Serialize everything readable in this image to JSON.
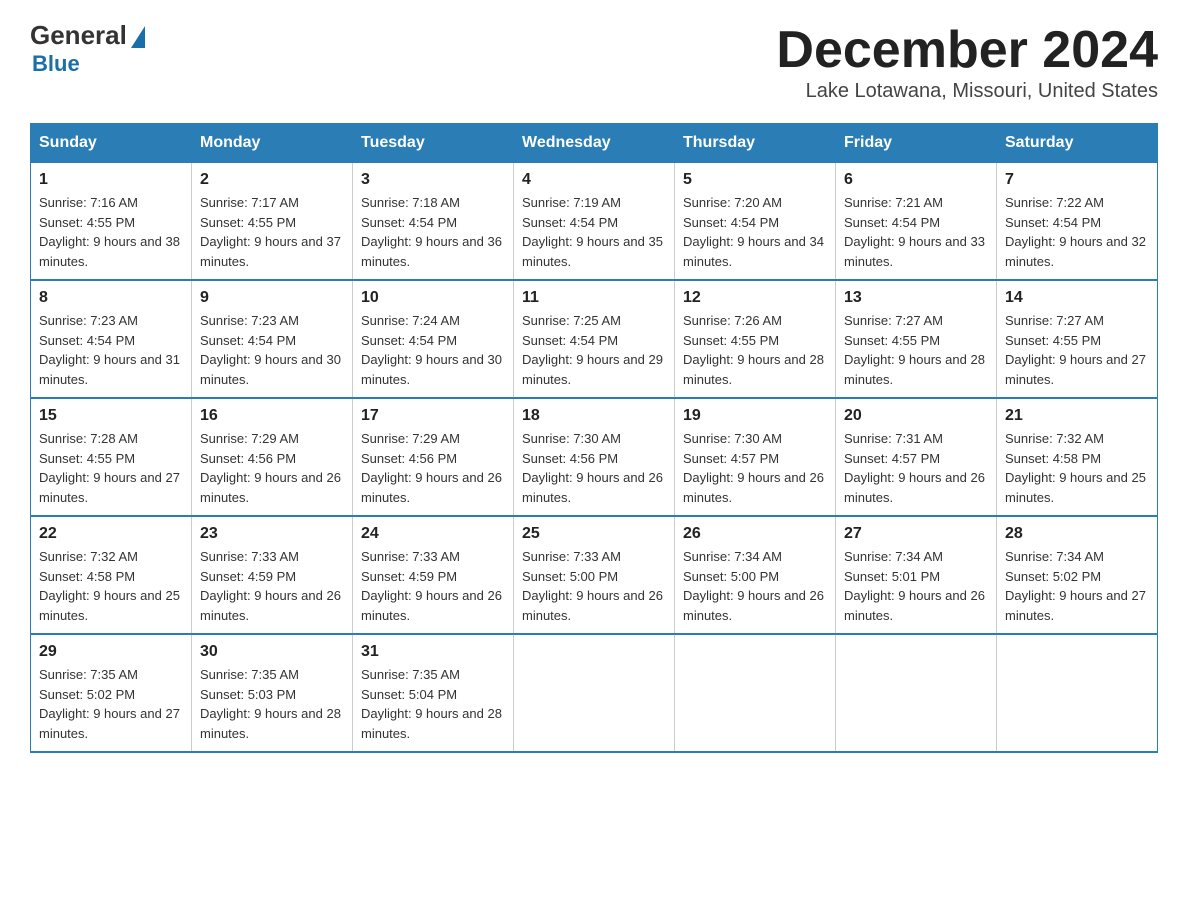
{
  "logo": {
    "general": "General",
    "blue": "Blue"
  },
  "header": {
    "month_year": "December 2024",
    "location": "Lake Lotawana, Missouri, United States"
  },
  "days_of_week": [
    "Sunday",
    "Monday",
    "Tuesday",
    "Wednesday",
    "Thursday",
    "Friday",
    "Saturday"
  ],
  "weeks": [
    [
      {
        "day": "1",
        "sunrise": "7:16 AM",
        "sunset": "4:55 PM",
        "daylight": "9 hours and 38 minutes."
      },
      {
        "day": "2",
        "sunrise": "7:17 AM",
        "sunset": "4:55 PM",
        "daylight": "9 hours and 37 minutes."
      },
      {
        "day": "3",
        "sunrise": "7:18 AM",
        "sunset": "4:54 PM",
        "daylight": "9 hours and 36 minutes."
      },
      {
        "day": "4",
        "sunrise": "7:19 AM",
        "sunset": "4:54 PM",
        "daylight": "9 hours and 35 minutes."
      },
      {
        "day": "5",
        "sunrise": "7:20 AM",
        "sunset": "4:54 PM",
        "daylight": "9 hours and 34 minutes."
      },
      {
        "day": "6",
        "sunrise": "7:21 AM",
        "sunset": "4:54 PM",
        "daylight": "9 hours and 33 minutes."
      },
      {
        "day": "7",
        "sunrise": "7:22 AM",
        "sunset": "4:54 PM",
        "daylight": "9 hours and 32 minutes."
      }
    ],
    [
      {
        "day": "8",
        "sunrise": "7:23 AM",
        "sunset": "4:54 PM",
        "daylight": "9 hours and 31 minutes."
      },
      {
        "day": "9",
        "sunrise": "7:23 AM",
        "sunset": "4:54 PM",
        "daylight": "9 hours and 30 minutes."
      },
      {
        "day": "10",
        "sunrise": "7:24 AM",
        "sunset": "4:54 PM",
        "daylight": "9 hours and 30 minutes."
      },
      {
        "day": "11",
        "sunrise": "7:25 AM",
        "sunset": "4:54 PM",
        "daylight": "9 hours and 29 minutes."
      },
      {
        "day": "12",
        "sunrise": "7:26 AM",
        "sunset": "4:55 PM",
        "daylight": "9 hours and 28 minutes."
      },
      {
        "day": "13",
        "sunrise": "7:27 AM",
        "sunset": "4:55 PM",
        "daylight": "9 hours and 28 minutes."
      },
      {
        "day": "14",
        "sunrise": "7:27 AM",
        "sunset": "4:55 PM",
        "daylight": "9 hours and 27 minutes."
      }
    ],
    [
      {
        "day": "15",
        "sunrise": "7:28 AM",
        "sunset": "4:55 PM",
        "daylight": "9 hours and 27 minutes."
      },
      {
        "day": "16",
        "sunrise": "7:29 AM",
        "sunset": "4:56 PM",
        "daylight": "9 hours and 26 minutes."
      },
      {
        "day": "17",
        "sunrise": "7:29 AM",
        "sunset": "4:56 PM",
        "daylight": "9 hours and 26 minutes."
      },
      {
        "day": "18",
        "sunrise": "7:30 AM",
        "sunset": "4:56 PM",
        "daylight": "9 hours and 26 minutes."
      },
      {
        "day": "19",
        "sunrise": "7:30 AM",
        "sunset": "4:57 PM",
        "daylight": "9 hours and 26 minutes."
      },
      {
        "day": "20",
        "sunrise": "7:31 AM",
        "sunset": "4:57 PM",
        "daylight": "9 hours and 26 minutes."
      },
      {
        "day": "21",
        "sunrise": "7:32 AM",
        "sunset": "4:58 PM",
        "daylight": "9 hours and 25 minutes."
      }
    ],
    [
      {
        "day": "22",
        "sunrise": "7:32 AM",
        "sunset": "4:58 PM",
        "daylight": "9 hours and 25 minutes."
      },
      {
        "day": "23",
        "sunrise": "7:33 AM",
        "sunset": "4:59 PM",
        "daylight": "9 hours and 26 minutes."
      },
      {
        "day": "24",
        "sunrise": "7:33 AM",
        "sunset": "4:59 PM",
        "daylight": "9 hours and 26 minutes."
      },
      {
        "day": "25",
        "sunrise": "7:33 AM",
        "sunset": "5:00 PM",
        "daylight": "9 hours and 26 minutes."
      },
      {
        "day": "26",
        "sunrise": "7:34 AM",
        "sunset": "5:00 PM",
        "daylight": "9 hours and 26 minutes."
      },
      {
        "day": "27",
        "sunrise": "7:34 AM",
        "sunset": "5:01 PM",
        "daylight": "9 hours and 26 minutes."
      },
      {
        "day": "28",
        "sunrise": "7:34 AM",
        "sunset": "5:02 PM",
        "daylight": "9 hours and 27 minutes."
      }
    ],
    [
      {
        "day": "29",
        "sunrise": "7:35 AM",
        "sunset": "5:02 PM",
        "daylight": "9 hours and 27 minutes."
      },
      {
        "day": "30",
        "sunrise": "7:35 AM",
        "sunset": "5:03 PM",
        "daylight": "9 hours and 28 minutes."
      },
      {
        "day": "31",
        "sunrise": "7:35 AM",
        "sunset": "5:04 PM",
        "daylight": "9 hours and 28 minutes."
      },
      null,
      null,
      null,
      null
    ]
  ]
}
